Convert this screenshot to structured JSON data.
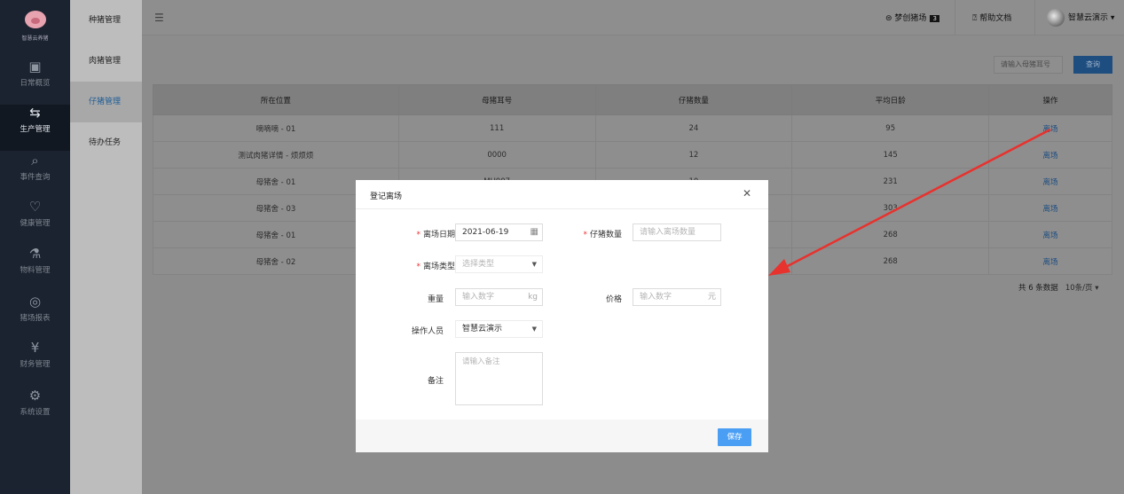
{
  "brand": {
    "name": "智慧云养猪"
  },
  "sidebar": {
    "items": [
      {
        "label": "日常概览",
        "icon": "overview-icon",
        "glyph": "▣"
      },
      {
        "label": "生产管理",
        "icon": "production-icon",
        "glyph": "⇆"
      },
      {
        "label": "事件查询",
        "icon": "search-doc-icon",
        "glyph": "⌕"
      },
      {
        "label": "健康管理",
        "icon": "health-icon",
        "glyph": "♡"
      },
      {
        "label": "物料管理",
        "icon": "material-icon",
        "glyph": "⚗"
      },
      {
        "label": "猪场报表",
        "icon": "report-icon",
        "glyph": "◎"
      },
      {
        "label": "财务管理",
        "icon": "finance-icon",
        "glyph": "¥"
      },
      {
        "label": "系统设置",
        "icon": "settings-icon",
        "glyph": "⚙"
      }
    ]
  },
  "submenu": {
    "items": [
      {
        "label": "种猪管理"
      },
      {
        "label": "肉猪管理"
      },
      {
        "label": "仔猪管理"
      },
      {
        "label": "待办任务"
      }
    ]
  },
  "header": {
    "farm_name": "梦创猪场",
    "farm_badge": "3",
    "help_label": "帮助文档",
    "user_name": "智慧云演示"
  },
  "search": {
    "placeholder": "请输入母猪耳号",
    "button_label": "查询"
  },
  "table": {
    "columns": [
      "所在位置",
      "母猪耳号",
      "仔猪数量",
      "平均日龄",
      "操作"
    ],
    "rows": [
      [
        "嘀嘀嘀 - 01",
        "111",
        "24",
        "95",
        "离场"
      ],
      [
        "测试肉猪详情 - 烦烦烦",
        "0000",
        "12",
        "145",
        "离场"
      ],
      [
        "母猪舍 - 01",
        "MU007",
        "10",
        "231",
        "离场"
      ],
      [
        "母猪舍 - 03",
        "",
        "",
        "303",
        "离场"
      ],
      [
        "母猪舍 - 01",
        "",
        "",
        "268",
        "离场"
      ],
      [
        "母猪舍 - 02",
        "",
        "",
        "268",
        "离场"
      ]
    ]
  },
  "pagination": {
    "total": "共 6 条数据",
    "page_size": "10条/页 ▾"
  },
  "modal": {
    "title": "登记离场",
    "close": "✕",
    "fields": {
      "leave_date": {
        "label": "离场日期",
        "value": "2021-06-19"
      },
      "piglet_count": {
        "label": "仔猪数量",
        "placeholder": "请输入离场数量"
      },
      "leave_type": {
        "label": "离场类型",
        "placeholder": "选择类型"
      },
      "weight": {
        "label": "重量",
        "placeholder": "输入数字",
        "unit": "kg"
      },
      "price": {
        "label": "价格",
        "placeholder": "输入数字",
        "unit": "元"
      },
      "operator": {
        "label": "操作人员",
        "value": "智慧云演示"
      },
      "remark": {
        "label": "备注",
        "placeholder": "请输入备注"
      }
    },
    "save_label": "保存"
  },
  "colors": {
    "sidebar": "#1c2330",
    "primary": "#4a9ff5",
    "required": "#e33333",
    "arrow": "#e8322e"
  }
}
